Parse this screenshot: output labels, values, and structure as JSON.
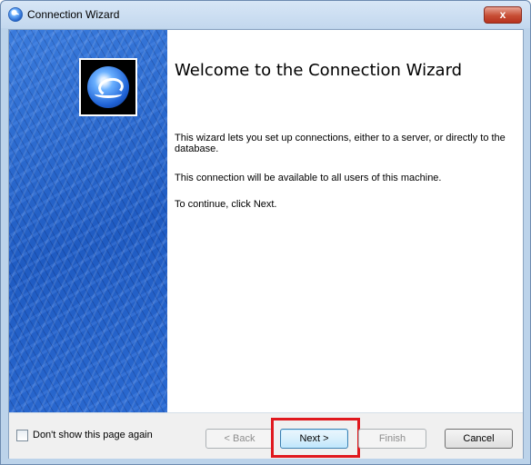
{
  "window": {
    "title": "Connection Wizard",
    "close_label": "x",
    "app_icon": "globe-icon"
  },
  "main": {
    "heading": "Welcome to the Connection Wizard",
    "paragraphs": [
      "This wizard lets you set up connections, either to a server, or directly to the database.",
      "This connection will be available to all users of this machine.",
      "To continue, click Next."
    ],
    "logo_icon": "globe-logo-icon"
  },
  "footer": {
    "checkbox_label": "Don't show this page again",
    "checkbox_checked": false,
    "back_label": "< Back",
    "next_label": "Next >",
    "finish_label": "Finish",
    "cancel_label": "Cancel"
  },
  "colors": {
    "side_panel": "#2b6ad1",
    "highlight": "#e0191e",
    "close_button": "#c74d34"
  }
}
